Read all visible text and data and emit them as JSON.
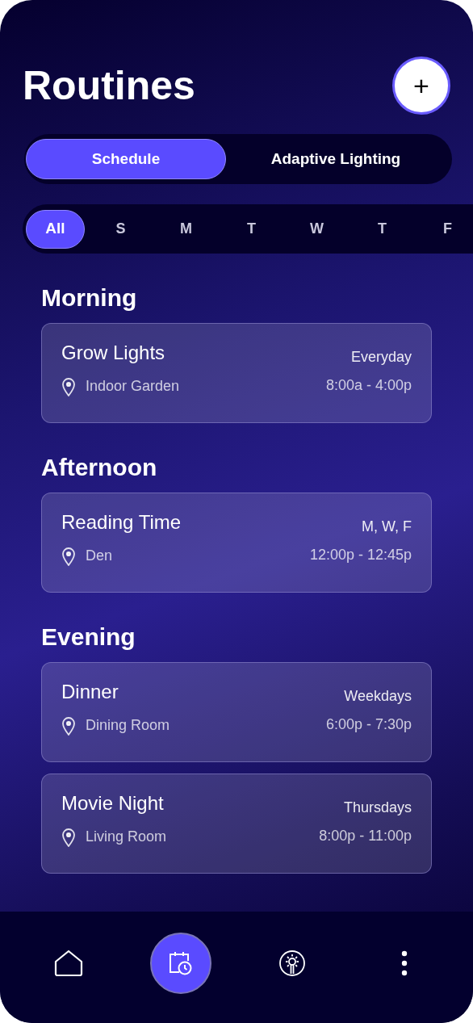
{
  "title": "Routines",
  "add_button": {
    "label": "+"
  },
  "mode_tabs": [
    {
      "label": "Schedule",
      "selected": true
    },
    {
      "label": "Adaptive Lighting",
      "selected": false
    }
  ],
  "day_filter": [
    {
      "label": "All",
      "selected": true
    },
    {
      "label": "S",
      "selected": false
    },
    {
      "label": "M",
      "selected": false
    },
    {
      "label": "T",
      "selected": false
    },
    {
      "label": "W",
      "selected": false
    },
    {
      "label": "T",
      "selected": false
    },
    {
      "label": "F",
      "selected": false
    }
  ],
  "sections": [
    {
      "heading": "Morning",
      "routines": [
        {
          "name": "Grow Lights",
          "location": "Indoor Garden",
          "days": "Everyday",
          "time": "8:00a - 4:00p"
        }
      ]
    },
    {
      "heading": "Afternoon",
      "routines": [
        {
          "name": "Reading Time",
          "location": "Den",
          "days": "M, W, F",
          "time": "12:00p - 12:45p"
        }
      ]
    },
    {
      "heading": "Evening",
      "routines": [
        {
          "name": "Dinner",
          "location": "Dining Room",
          "days": "Weekdays",
          "time": "6:00p - 7:30p"
        },
        {
          "name": "Movie Night",
          "location": "Living Room",
          "days": "Thursdays",
          "time": "8:00p - 11:00p"
        }
      ]
    }
  ],
  "nav": [
    {
      "kind": "home",
      "selected": false
    },
    {
      "kind": "schedule",
      "selected": true
    },
    {
      "kind": "lighting",
      "selected": false
    },
    {
      "kind": "more",
      "selected": false
    }
  ]
}
